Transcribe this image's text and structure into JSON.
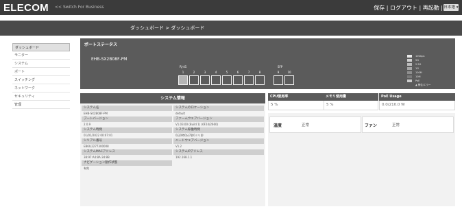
{
  "header": {
    "logo": "ELECOM",
    "subtitle": "<< Switch For Business",
    "links": "保存 | ログアウト | 再起動 |",
    "language": "日本語 ▾"
  },
  "breadcrumb": "ダッシュボード > ダッシュボード",
  "sidebar": {
    "items": [
      {
        "label": "ダッシュボード"
      },
      {
        "label": "モニター"
      },
      {
        "label": "システム"
      },
      {
        "label": "ポート"
      },
      {
        "label": "スイッチング"
      },
      {
        "label": "ネットワーク"
      },
      {
        "label": "セキュリティ"
      },
      {
        "label": "管理"
      }
    ]
  },
  "port_status": {
    "title": "ポートステータス",
    "model": "EHB-SX2B08F-PM",
    "groups": {
      "rj45": "RJ-45",
      "sfp": "SFP"
    },
    "ports": [
      {
        "num": "1",
        "linked": true
      },
      {
        "num": "2",
        "linked": false
      },
      {
        "num": "3",
        "linked": false
      },
      {
        "num": "4",
        "linked": false
      },
      {
        "num": "5",
        "linked": false
      },
      {
        "num": "6",
        "linked": false
      },
      {
        "num": "7",
        "linked": false
      },
      {
        "num": "8",
        "linked": false
      },
      {
        "num": "9",
        "linked": false
      },
      {
        "num": "10",
        "linked": false
      }
    ],
    "legend": [
      {
        "label": "10Gbps",
        "color": "#e8e8e8"
      },
      {
        "label": "5G",
        "color": "#d2d2d2"
      },
      {
        "label": "2.5G",
        "color": "#bdbdbd"
      },
      {
        "label": "1G",
        "color": "#a8a8a8"
      },
      {
        "label": "100M",
        "color": "#8f8f8f"
      },
      {
        "label": "10M",
        "color": "#7a7a7a"
      },
      {
        "label": "PoE",
        "color": "#cccccc"
      },
      {
        "label": "▲ 警告/エラー",
        "color": "#5b5b5b"
      }
    ]
  },
  "system_info": {
    "title": "システム情報",
    "rows": [
      [
        {
          "label": "システム名",
          "value": "EHB-SX2B08F-PM"
        },
        {
          "label": "システムのロケーション",
          "value": "default"
        }
      ],
      [
        {
          "label": "ブートバージョン",
          "value": "2.0.9"
        },
        {
          "label": "ファームウェアバージョン",
          "value": "V1.03.00 (Build 1) (6F24/2660)"
        }
      ],
      [
        {
          "label": "システム時間",
          "value": "01/01/2022 00:07:01"
        },
        {
          "label": "システム稼働時間",
          "value": "0日0時0分7秒0ミリ秒"
        }
      ],
      [
        {
          "label": "シリアル番号",
          "value": "EB6IL2277300008"
        },
        {
          "label": "ハードウェアバージョン",
          "value": "V1.2"
        }
      ],
      [
        {
          "label": "システムMACアドレス",
          "value": "38:97:A4:8A:34:8B"
        },
        {
          "label": "システムIPアドレス",
          "value": "192.168.1.1"
        }
      ],
      [
        {
          "label": "ナビゲーション動作状態",
          "value": "有効"
        },
        null
      ]
    ]
  },
  "cards": {
    "cpu": {
      "title": "CPU使用率",
      "value": "5 %"
    },
    "memory": {
      "title": "メモリ使用量",
      "value": "5 %"
    },
    "poe": {
      "title": "PoE Usage",
      "value": "0.0/210.0 W"
    }
  },
  "status": {
    "temp_label": "温度",
    "temp_value": "正常",
    "fan_label": "ファン",
    "fan_value": "正常"
  }
}
